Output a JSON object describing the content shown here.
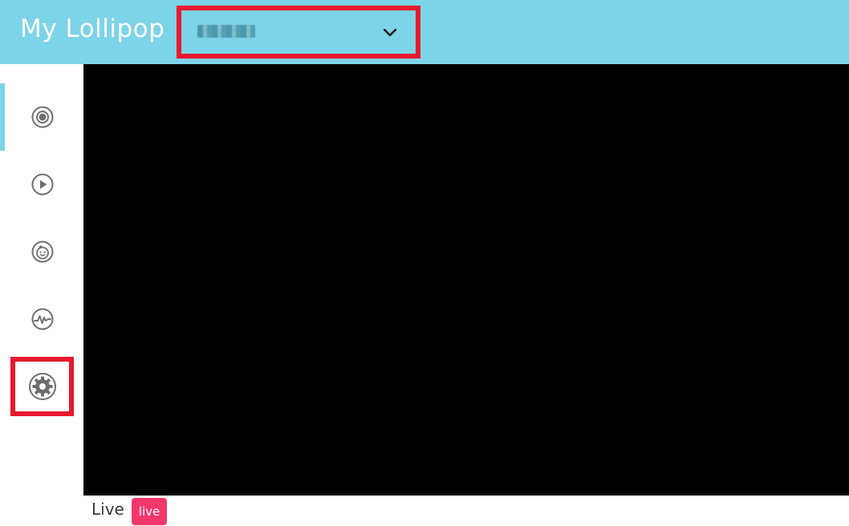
{
  "header": {
    "app_title": "My Lollipop",
    "device_select": {
      "selected_value": "",
      "icon": "chevron-down-icon"
    },
    "background_color": "#7dd3e8",
    "highlight_color": "#e8192c"
  },
  "sidebar": {
    "active_index": 0,
    "items": [
      {
        "name": "camera",
        "icon": "camera-lens-icon"
      },
      {
        "name": "playback",
        "icon": "play-icon"
      },
      {
        "name": "baby",
        "icon": "baby-face-icon"
      },
      {
        "name": "activity",
        "icon": "activity-pulse-icon"
      },
      {
        "name": "settings",
        "icon": "gear-icon"
      }
    ]
  },
  "main": {
    "status_label": "Live",
    "status_badge": "live",
    "badge_color": "#f0386b"
  }
}
